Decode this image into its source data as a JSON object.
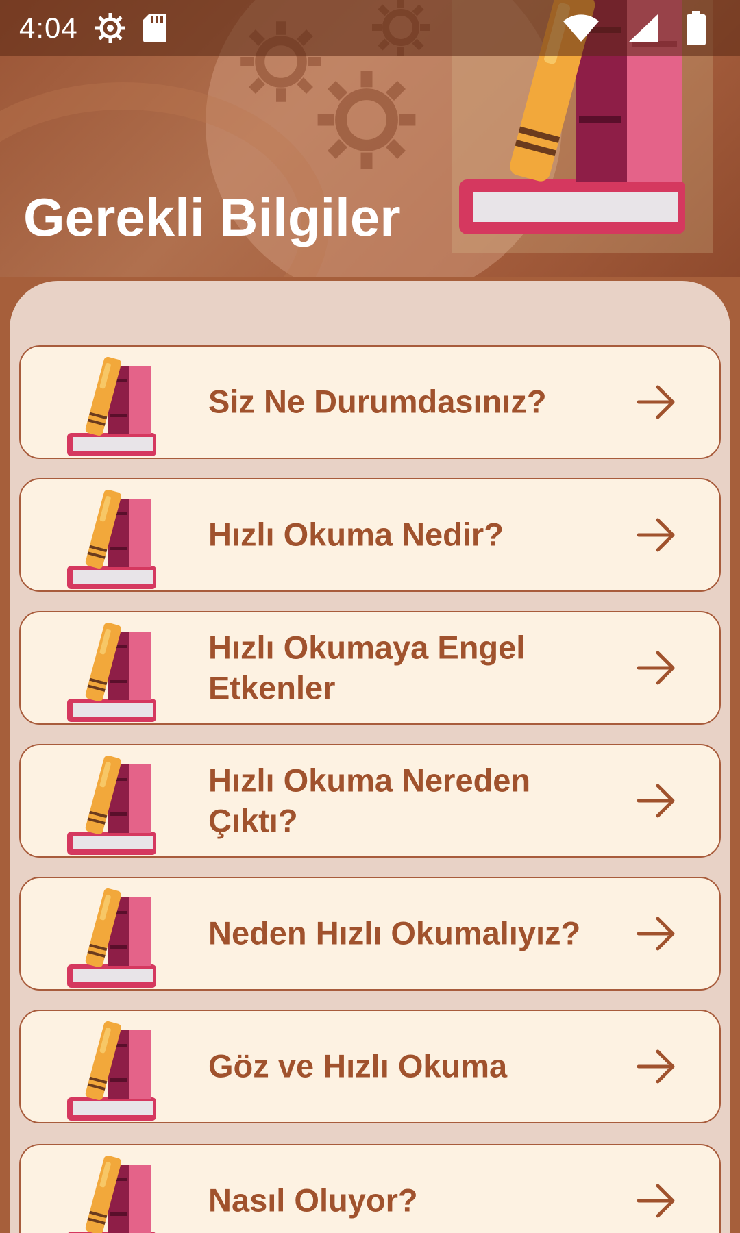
{
  "status_bar": {
    "time": "4:04",
    "icons": [
      "settings-icon",
      "sd-card-icon",
      "wifi-icon",
      "signal-icon",
      "battery-icon"
    ]
  },
  "header": {
    "title": "Gerekli Bilgiler",
    "art": "books-icon"
  },
  "menu": {
    "items": [
      {
        "label": "Siz Ne Durumdasınız?",
        "icon": "books-icon",
        "action_icon": "arrow-right-icon"
      },
      {
        "label": "Hızlı Okuma Nedir?",
        "icon": "books-icon",
        "action_icon": "arrow-right-icon"
      },
      {
        "label": "Hızlı Okumaya Engel Etkenler",
        "icon": "books-icon",
        "action_icon": "arrow-right-icon"
      },
      {
        "label": "Hızlı Okuma Nereden Çıktı?",
        "icon": "books-icon",
        "action_icon": "arrow-right-icon"
      },
      {
        "label": "Neden Hızlı Okumalıyız?",
        "icon": "books-icon",
        "action_icon": "arrow-right-icon"
      },
      {
        "label": "Göz ve Hızlı Okuma",
        "icon": "books-icon",
        "action_icon": "arrow-right-icon"
      },
      {
        "label": "Nasıl Oluyor?",
        "icon": "books-icon",
        "action_icon": "arrow-right-icon"
      }
    ]
  },
  "colors": {
    "background": "#a65f3b",
    "panel": "#e8d2c6",
    "card": "#fdf2e2",
    "card_border": "#a85c3c",
    "text_accent": "#a0522d"
  }
}
